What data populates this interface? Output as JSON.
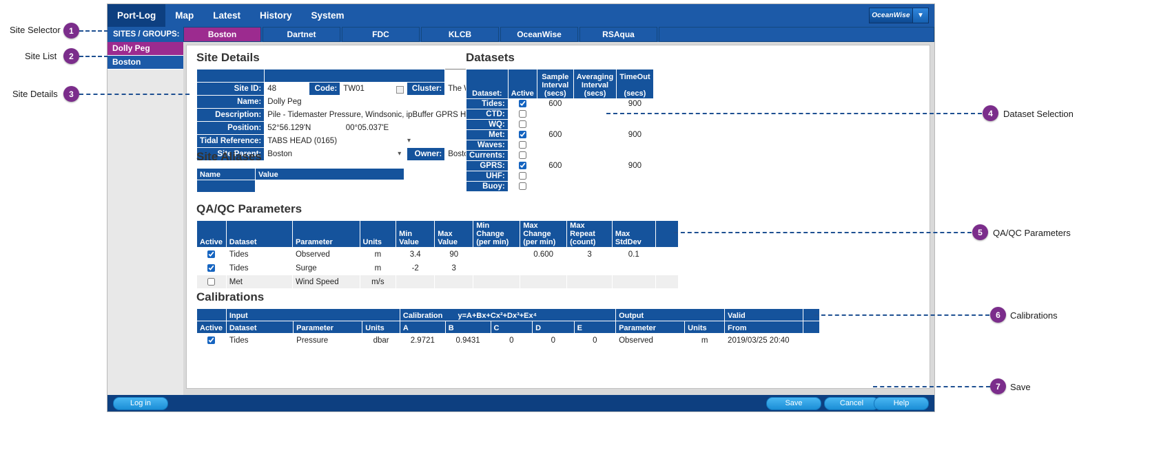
{
  "annotations": [
    {
      "n": "1",
      "label": "Site Selector"
    },
    {
      "n": "2",
      "label": "Site List"
    },
    {
      "n": "3",
      "label": "Site Details"
    },
    {
      "n": "4",
      "label": "Dataset Selection"
    },
    {
      "n": "5",
      "label": "QA/QC Parameters"
    },
    {
      "n": "6",
      "label": "Calibrations"
    },
    {
      "n": "7",
      "label": "Save"
    }
  ],
  "topnav": {
    "items": [
      {
        "label": "Port-Log",
        "active": true
      },
      {
        "label": "Map",
        "active": false
      },
      {
        "label": "Latest",
        "active": false
      },
      {
        "label": "History",
        "active": false
      },
      {
        "label": "System",
        "active": false
      }
    ],
    "logo_text": "OceanWise",
    "logo_caret": "▼"
  },
  "sitebar": {
    "label": "SITES / GROUPS:",
    "groups": [
      {
        "label": "Boston",
        "active": true
      },
      {
        "label": "Dartnet",
        "active": false
      },
      {
        "label": "FDC",
        "active": false
      },
      {
        "label": "KLCB",
        "active": false
      },
      {
        "label": "OceanWise",
        "active": false
      },
      {
        "label": "RSAqua",
        "active": false
      }
    ]
  },
  "sitelist": {
    "entries": [
      {
        "label": "Dolly Peg",
        "selected": true
      },
      {
        "label": "Boston",
        "selected": false
      }
    ]
  },
  "site_details": {
    "heading": "Site Details",
    "site_id_label": "Site ID:",
    "site_id_value": "48",
    "code_label": "Code:",
    "code_value": "TW01",
    "cluster_label": "Cluster:",
    "cluster_value": "The Wash",
    "name_label": "Name:",
    "name_value": "Dolly Peg",
    "description_label": "Description:",
    "description_value": "Pile - Tidemaster Pressure, Windsonic, ipBuffer GPRS HTTP Post",
    "position_label": "Position:",
    "position_lat": "52°56.129'N",
    "position_lon": "00°05.037'E",
    "tidal_reference_label": "Tidal Reference:",
    "tidal_reference_value": "TABS HEAD (0165)",
    "site_parent_label": "Site Parent:",
    "site_parent_value": "Boston",
    "owner_label": "Owner:",
    "owner_value": "Boston"
  },
  "site_aliases": {
    "heading": "Site Aliases",
    "columns": [
      "Name",
      "Value"
    ],
    "rows": [
      [
        "",
        ""
      ]
    ]
  },
  "datasets": {
    "heading": "Datasets",
    "columns": [
      "Dataset:",
      "Active",
      "Sample Interval (secs)",
      "Averaging Interval (secs)",
      "TimeOut (secs)"
    ],
    "column_lines": [
      [
        "",
        "",
        "Dataset:"
      ],
      [
        "",
        "",
        "Active"
      ],
      [
        "Sample",
        "Interval",
        "(secs)"
      ],
      [
        "Averaging",
        "Interval",
        "(secs)"
      ],
      [
        "TimeOut",
        "",
        "(secs)"
      ]
    ],
    "rows": [
      {
        "name": "Tides:",
        "active": true,
        "sample": "600",
        "averaging": "",
        "timeout": "900"
      },
      {
        "name": "CTD:",
        "active": false,
        "sample": "",
        "averaging": "",
        "timeout": ""
      },
      {
        "name": "WQ:",
        "active": false,
        "sample": "",
        "averaging": "",
        "timeout": ""
      },
      {
        "name": "Met:",
        "active": true,
        "sample": "600",
        "averaging": "",
        "timeout": "900"
      },
      {
        "name": "Waves:",
        "active": false,
        "sample": "",
        "averaging": "",
        "timeout": ""
      },
      {
        "name": "Currents:",
        "active": false,
        "sample": "",
        "averaging": "",
        "timeout": ""
      },
      {
        "name": "GPRS:",
        "active": true,
        "sample": "600",
        "averaging": "",
        "timeout": "900"
      },
      {
        "name": "UHF:",
        "active": false,
        "sample": "",
        "averaging": "",
        "timeout": ""
      },
      {
        "name": "Buoy:",
        "active": false,
        "sample": "",
        "averaging": "",
        "timeout": ""
      }
    ]
  },
  "qaqc": {
    "heading": "QA/QC Parameters",
    "column_lines": [
      [
        "",
        "Active"
      ],
      [
        "",
        "Dataset"
      ],
      [
        "",
        "Parameter"
      ],
      [
        "",
        "Units"
      ],
      [
        "Min",
        "Value"
      ],
      [
        "Max",
        "Value"
      ],
      [
        "Min Change",
        "(per min)"
      ],
      [
        "Max Change",
        "(per min)"
      ],
      [
        "Max Repeat",
        "(count)"
      ],
      [
        "Max",
        "StdDev"
      ],
      [
        "",
        ""
      ]
    ],
    "rows": [
      {
        "active": true,
        "dataset": "Tides",
        "parameter": "Observed",
        "units": "m",
        "min_value": "3.4",
        "max_value": "90",
        "min_change": "",
        "max_change": "0.600",
        "max_repeat": "3",
        "max_stddev": "0.1",
        "enabled": true
      },
      {
        "active": true,
        "dataset": "Tides",
        "parameter": "Surge",
        "units": "m",
        "min_value": "-2",
        "max_value": "3",
        "min_change": "",
        "max_change": "",
        "max_repeat": "",
        "max_stddev": "",
        "enabled": true
      },
      {
        "active": false,
        "dataset": "Met",
        "parameter": "Wind Speed",
        "units": "m/s",
        "min_value": "",
        "max_value": "",
        "min_change": "",
        "max_change": "",
        "max_repeat": "",
        "max_stddev": "",
        "enabled": false
      }
    ]
  },
  "calibrations": {
    "heading": "Calibrations",
    "group_headers": [
      {
        "label": "",
        "span": 1
      },
      {
        "label": "Input",
        "span": 3
      },
      {
        "label": "Calibration",
        "span": 5,
        "formula": "y=A+Bx+Cx²+Dx³+Ex⁴"
      },
      {
        "label": "Output",
        "span": 2
      },
      {
        "label": "Valid",
        "span": 2
      }
    ],
    "columns": [
      "Active",
      "Dataset",
      "Parameter",
      "Units",
      "A",
      "B",
      "C",
      "D",
      "E",
      "Parameter",
      "Units",
      "From"
    ],
    "rows": [
      {
        "active": true,
        "dataset": "Tides",
        "parameter": "Pressure",
        "units": "dbar",
        "a": "2.9721",
        "b": "0.9431",
        "c": "0",
        "d": "0",
        "e": "0",
        "out_parameter": "Observed",
        "out_units": "m",
        "valid_from": "2019/03/25 20:40"
      }
    ]
  },
  "bottombar": {
    "login": "Log in",
    "save": "Save",
    "cancel": "Cancel",
    "help": "Help"
  }
}
